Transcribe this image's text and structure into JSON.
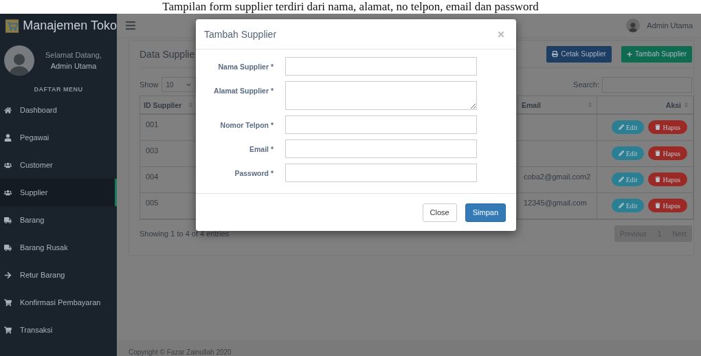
{
  "caption": "Tampilan form supplier terdiri dari nama, alamat, no telpon, email dan password",
  "brand": "Manajemen Toko",
  "header": {
    "user_name": "Admin Utama"
  },
  "sidebar": {
    "greeting": "Selamat Datang,",
    "user_name": "Admin Utama",
    "menu_title": "DAFTAR MENU",
    "items": [
      {
        "label": "Dashboard",
        "kind": "home",
        "selected": false
      },
      {
        "label": "Pegawai",
        "kind": "user",
        "selected": false
      },
      {
        "label": "Customer",
        "kind": "users",
        "selected": false
      },
      {
        "label": "Supplier",
        "kind": "users",
        "selected": true
      },
      {
        "label": "Barang",
        "kind": "truck",
        "selected": false
      },
      {
        "label": "Barang Rusak",
        "kind": "truck",
        "selected": false
      },
      {
        "label": "Retur Barang",
        "kind": "arrow",
        "selected": false
      },
      {
        "label": "Konfirmasi Pembayaran",
        "kind": "cart",
        "selected": false
      },
      {
        "label": "Transaksi",
        "kind": "cart",
        "selected": false
      }
    ]
  },
  "panel": {
    "title": "Data Supplie",
    "buttons": [
      {
        "label": "Cetak Supplier",
        "kind": "print"
      },
      {
        "label": "Tambah Supplier",
        "kind": "add"
      }
    ],
    "show_label": "Show",
    "show_value": "10",
    "search_label": "Search:",
    "table": {
      "columns": [
        "ID Supplier",
        "Email",
        "Aksi"
      ],
      "rows": [
        {
          "id": "001",
          "email": "",
          "actions": [
            {
              "label": "Edit",
              "kind": "edit"
            },
            {
              "label": "Hapus",
              "kind": "delete"
            }
          ]
        },
        {
          "id": "003",
          "email": "",
          "actions": [
            {
              "label": "Edit",
              "kind": "edit"
            },
            {
              "label": "Hapus",
              "kind": "delete"
            }
          ]
        },
        {
          "id": "004",
          "email": "coba2@gmail.com2",
          "actions": [
            {
              "label": "Edit",
              "kind": "edit"
            },
            {
              "label": "Hapus",
              "kind": "delete"
            }
          ]
        },
        {
          "id": "005",
          "email": "12345@gmail.com",
          "actions": [
            {
              "label": "Edit",
              "kind": "edit"
            },
            {
              "label": "Hapus",
              "kind": "delete"
            }
          ]
        }
      ]
    },
    "info": "Showing 1 to 4 of 4 entries",
    "pagination": {
      "previous": "Previous",
      "page": "1",
      "next": "Next"
    }
  },
  "footer": "Copyright © Fazar Zainullah 2020",
  "modal": {
    "title": "Tambah Supplier",
    "fields": [
      {
        "label": "Nama Supplier *",
        "kind": "input"
      },
      {
        "label": "Alamat Supplier *",
        "kind": "textarea"
      },
      {
        "label": "Nomor Telpon *",
        "kind": "input"
      },
      {
        "label": "Email *",
        "kind": "input"
      },
      {
        "label": "Password *",
        "kind": "input"
      }
    ],
    "buttons": [
      {
        "label": "Close",
        "kind": "default"
      },
      {
        "label": "Simpan",
        "kind": "primary"
      }
    ]
  }
}
